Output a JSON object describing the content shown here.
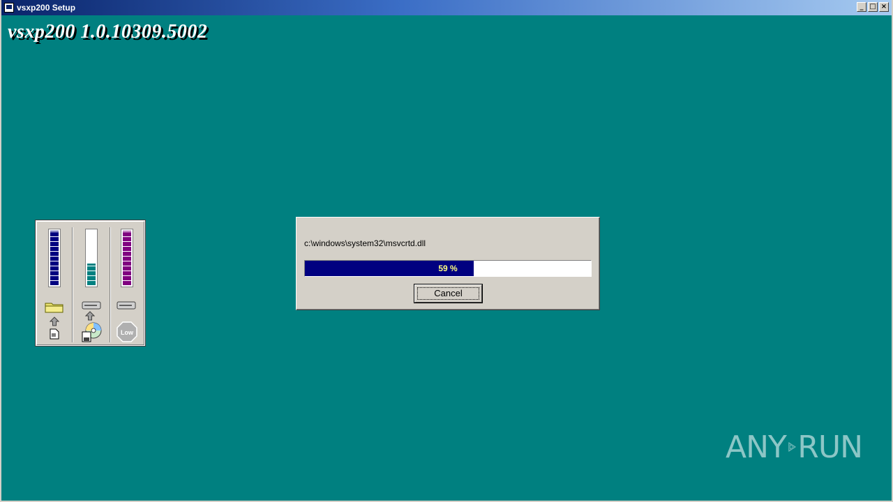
{
  "window": {
    "title": "vsxp200 Setup",
    "controls": {
      "minimize": "_",
      "maximize": "□",
      "close": "×"
    }
  },
  "app_heading": "vsxp200  1.0.10309.5002",
  "meters": {
    "gauges": [
      {
        "name": "source",
        "fill_fraction": 1.0,
        "color": "#000080"
      },
      {
        "name": "destination",
        "fill_fraction": 0.4,
        "color": "#008080"
      },
      {
        "name": "disk-space",
        "fill_fraction": 1.0,
        "color": "#800080"
      }
    ],
    "low_label": "Low"
  },
  "dialog": {
    "current_file": "c:\\windows\\system32\\msvcrtd.dll",
    "progress_percent": 59,
    "progress_text": "59 %",
    "cancel_label": "Cancel"
  },
  "watermark": {
    "left": "ANY",
    "right": "RUN"
  },
  "colors": {
    "desktop": "#008080",
    "progress": "#000080",
    "dialog": "#d4d0c8"
  }
}
